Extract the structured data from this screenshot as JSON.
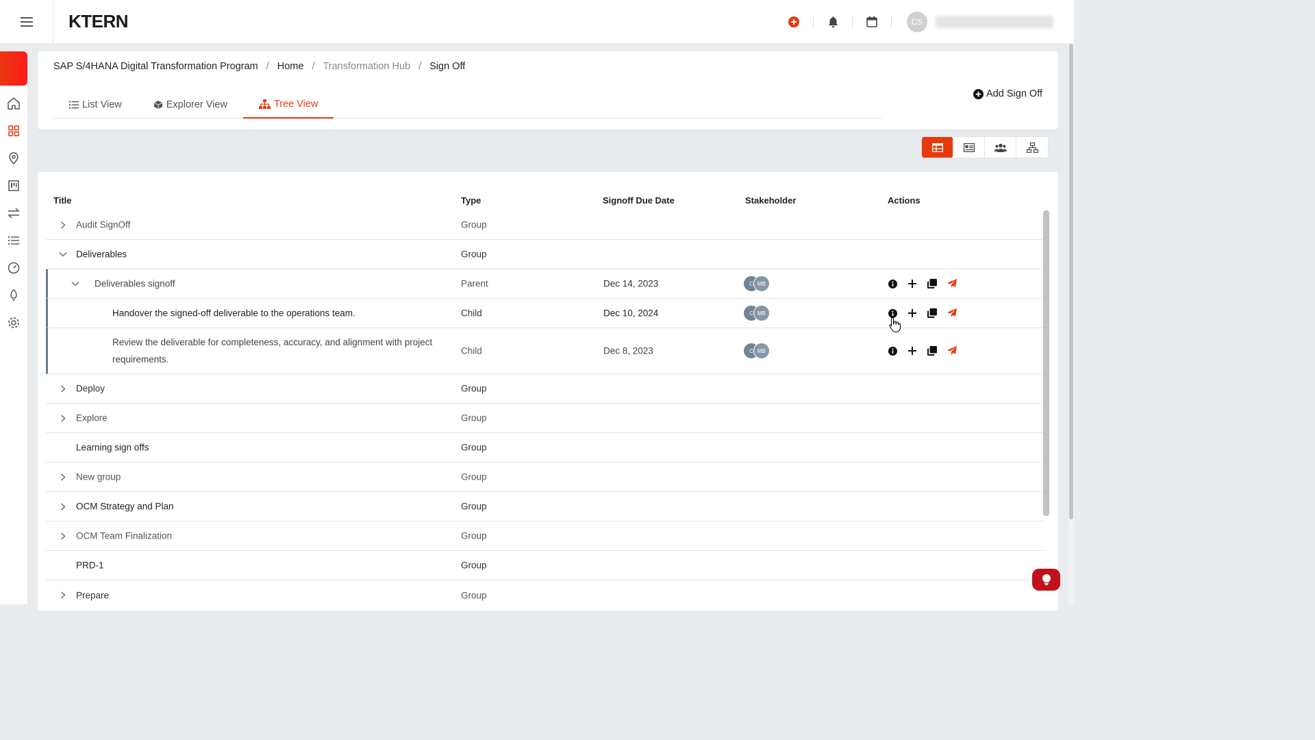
{
  "app": {
    "logo_text": "KTERN",
    "user_avatar_initials": "CS"
  },
  "breadcrumb": {
    "items": [
      "SAP S/4HANA Digital Transformation Program",
      "Home",
      "Transformation Hub",
      "Sign Off"
    ],
    "separator": "/"
  },
  "tabs": [
    {
      "label": "List View",
      "icon": "list-icon",
      "active": false
    },
    {
      "label": "Explorer View",
      "icon": "box-icon",
      "active": false
    },
    {
      "label": "Tree View",
      "icon": "sitemap-icon",
      "active": true
    }
  ],
  "header": {
    "add_label": "Add Sign Off"
  },
  "view_switch": [
    "table-view-icon",
    "card-view-icon",
    "users-view-icon",
    "hierarchy-view-icon"
  ],
  "table": {
    "columns": {
      "title": "Title",
      "type": "Type",
      "due": "Signoff Due Date",
      "stakeholder": "Stakeholder",
      "actions": "Actions"
    },
    "rows": [
      {
        "title": "Audit SignOff",
        "type": "Group",
        "due": "",
        "expand": "collapsed",
        "level": 0
      },
      {
        "title": "Deliverables",
        "type": "Group",
        "due": "",
        "expand": "expanded",
        "level": 0
      },
      {
        "title": "Deliverables signoff",
        "type": "Parent",
        "due": "Dec 14, 2023",
        "expand": "expanded",
        "level": 1,
        "stakeholders": [
          "C",
          "MB"
        ]
      },
      {
        "title": "Handover the signed-off deliverable to the operations team.",
        "type": "Child",
        "due": "Dec 10, 2024",
        "expand": "none",
        "level": 2,
        "stakeholders": [
          "C",
          "MB"
        ]
      },
      {
        "title_line1": "Review the deliverable for completeness, accuracy, and alignment with project",
        "title_line2": "requirements.",
        "type": "Child",
        "due": "Dec 8, 2023",
        "expand": "none",
        "level": 2,
        "stakeholders": [
          "C",
          "MB"
        ]
      },
      {
        "title": "Deploy",
        "type": "Group",
        "expand": "collapsed",
        "level": 0
      },
      {
        "title": "Explore",
        "type": "Group",
        "expand": "collapsed",
        "level": 0
      },
      {
        "title": "Learning sign offs",
        "type": "Group",
        "expand": "none",
        "level": 0
      },
      {
        "title": "New group",
        "type": "Group",
        "expand": "collapsed",
        "level": 0
      },
      {
        "title": "OCM Strategy and Plan",
        "type": "Group",
        "expand": "collapsed",
        "level": 0
      },
      {
        "title": "OCM Team Finalization",
        "type": "Group",
        "expand": "collapsed",
        "level": 0
      },
      {
        "title": "PRD-1",
        "type": "Group",
        "expand": "none",
        "level": 0
      },
      {
        "title": "Prepare",
        "type": "Group",
        "expand": "collapsed",
        "level": 0
      }
    ]
  },
  "colors": {
    "accent": "#e8380d",
    "avatar": "#6f8496",
    "help_button": "#c0121b"
  }
}
